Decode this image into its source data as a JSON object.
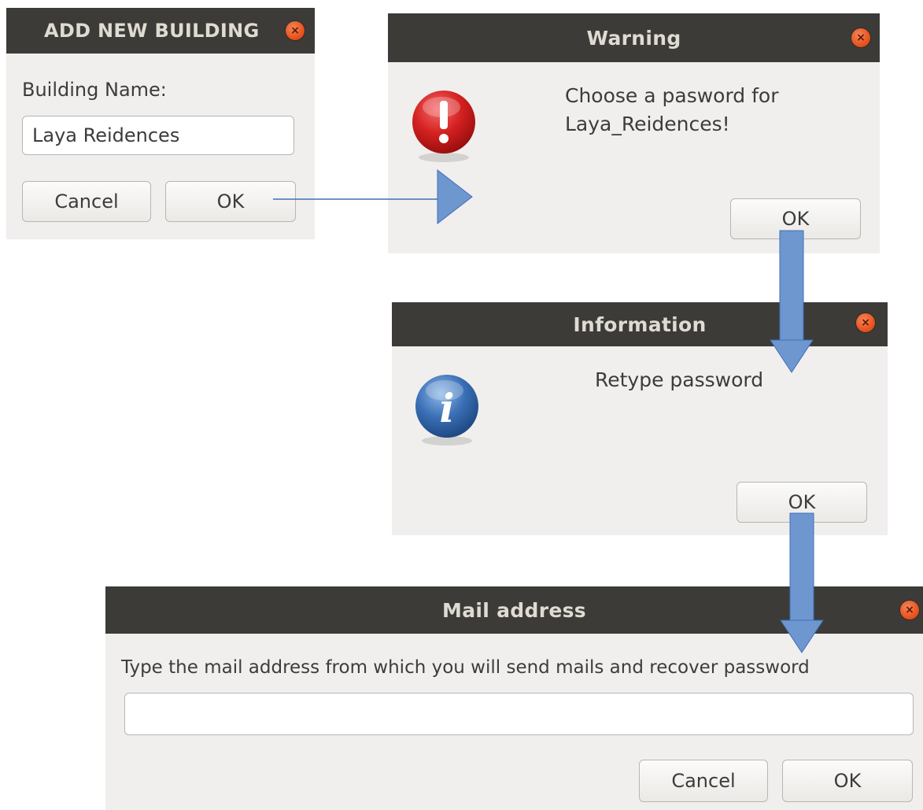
{
  "add_building": {
    "title": "ADD NEW BUILDING",
    "field_label": "Building Name:",
    "field_value": "Laya Reidences",
    "cancel_label": "Cancel",
    "ok_label": "OK"
  },
  "warning": {
    "title": "Warning",
    "message_line1": "Choose a pasword for",
    "message_line2": "Laya_Reidences!",
    "ok_label": "OK",
    "icon": "exclamation-icon"
  },
  "information": {
    "title": "Information",
    "message": "Retype password",
    "ok_label": "OK",
    "icon": "info-icon"
  },
  "mail": {
    "title": "Mail address",
    "prompt": "Type the mail address from which you will send mails and recover password",
    "input_value": "",
    "cancel_label": "Cancel",
    "ok_label": "OK"
  },
  "colors": {
    "titlebar": "#3c3b37",
    "dialog_bg": "#f0efee",
    "close_button": "#e9541f",
    "arrow": "#6f97cf"
  }
}
